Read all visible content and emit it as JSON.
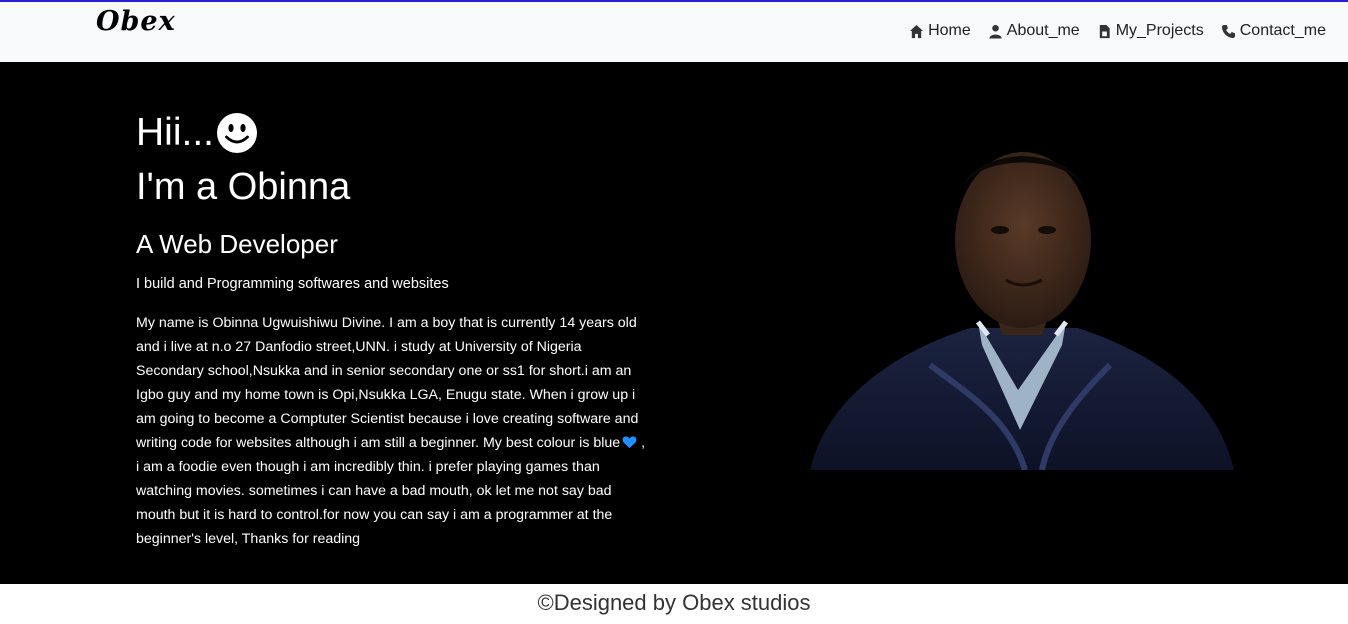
{
  "navbar": {
    "brand": "Obex",
    "links": [
      {
        "label": "Home",
        "icon": "home-icon"
      },
      {
        "label": "About_me",
        "icon": "user-icon"
      },
      {
        "label": "My_Projects",
        "icon": "file-icon"
      },
      {
        "label": "Contact_me",
        "icon": "phone-icon"
      }
    ]
  },
  "hero": {
    "greeting": "Hii...",
    "intro": "I'm a Obinna",
    "role": "A Web Developer",
    "tagline": "I build and Programming softwares and websites",
    "bio_before_heart": "My name is Obinna Ugwuishiwu Divine. I am a boy that is currently 14 years old and i live at n.o 27 Danfodio street,UNN. i study at University of Nigeria Secondary school,Nsukka and in senior secondary one or ss1 for short.i am an Igbo guy and my home town is Opi,Nsukka LGA, Enugu state. When i grow up i am going to become a Comptuter Scientist because i love creating software and writing code for websites although i am still a beginner. My best colour is blue",
    "bio_after_heart": " , i am a foodie even though i am incredibly thin. i prefer playing games than watching movies. sometimes i can have a bad mouth, ok let me not say bad mouth but it is hard to control.for now you can say i am a programmer at the beginner's level, Thanks for reading"
  },
  "footer": {
    "text": "©Designed by Obex studios"
  },
  "colors": {
    "navbar_top_border": "#2a1fd0",
    "hero_background": "#000000",
    "heart": "#1e90ff"
  }
}
